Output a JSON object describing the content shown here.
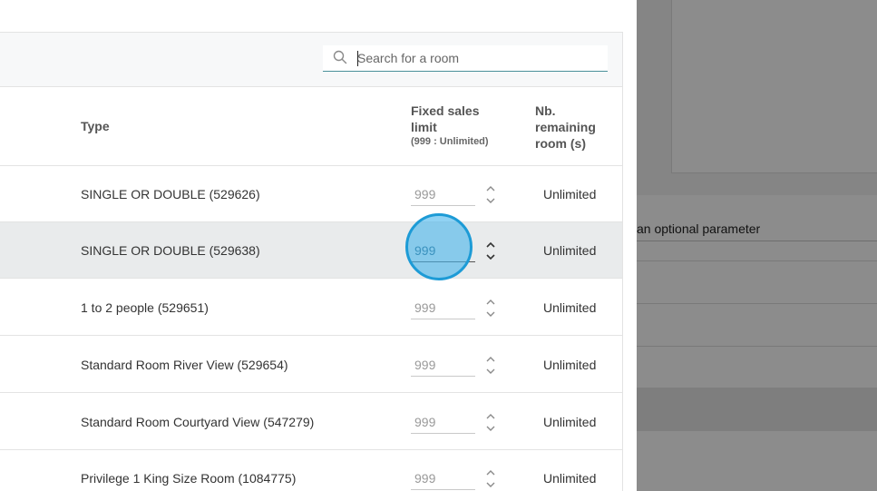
{
  "background": {
    "optional_param_text": "an optional parameter"
  },
  "search": {
    "placeholder": "Search for a room",
    "icon": "search-icon"
  },
  "table": {
    "headers": {
      "type": "Type",
      "fixed_sales_limit": "Fixed sales limit",
      "fixed_sales_limit_hint": "(999 : Unlimited)",
      "remaining": "Nb. remaining room (s)"
    },
    "rows": [
      {
        "type": "SINGLE OR DOUBLE (529626)",
        "limit": "999",
        "remaining": "Unlimited"
      },
      {
        "type": "SINGLE OR DOUBLE (529638)",
        "limit": "999",
        "remaining": "Unlimited"
      },
      {
        "type": "1 to 2 people (529651)",
        "limit": "999",
        "remaining": "Unlimited"
      },
      {
        "type": "Standard Room River View (529654)",
        "limit": "999",
        "remaining": "Unlimited"
      },
      {
        "type": "Standard Room Courtyard View (547279)",
        "limit": "999",
        "remaining": "Unlimited"
      },
      {
        "type": "Privilege 1 King Size Room (1084775)",
        "limit": "999",
        "remaining": "Unlimited"
      }
    ],
    "active_row": 1
  },
  "colors": {
    "accent_underline": "#4a8f9a",
    "active_row_bg": "#e9ebec",
    "click_marker": "#1d9bd6"
  }
}
